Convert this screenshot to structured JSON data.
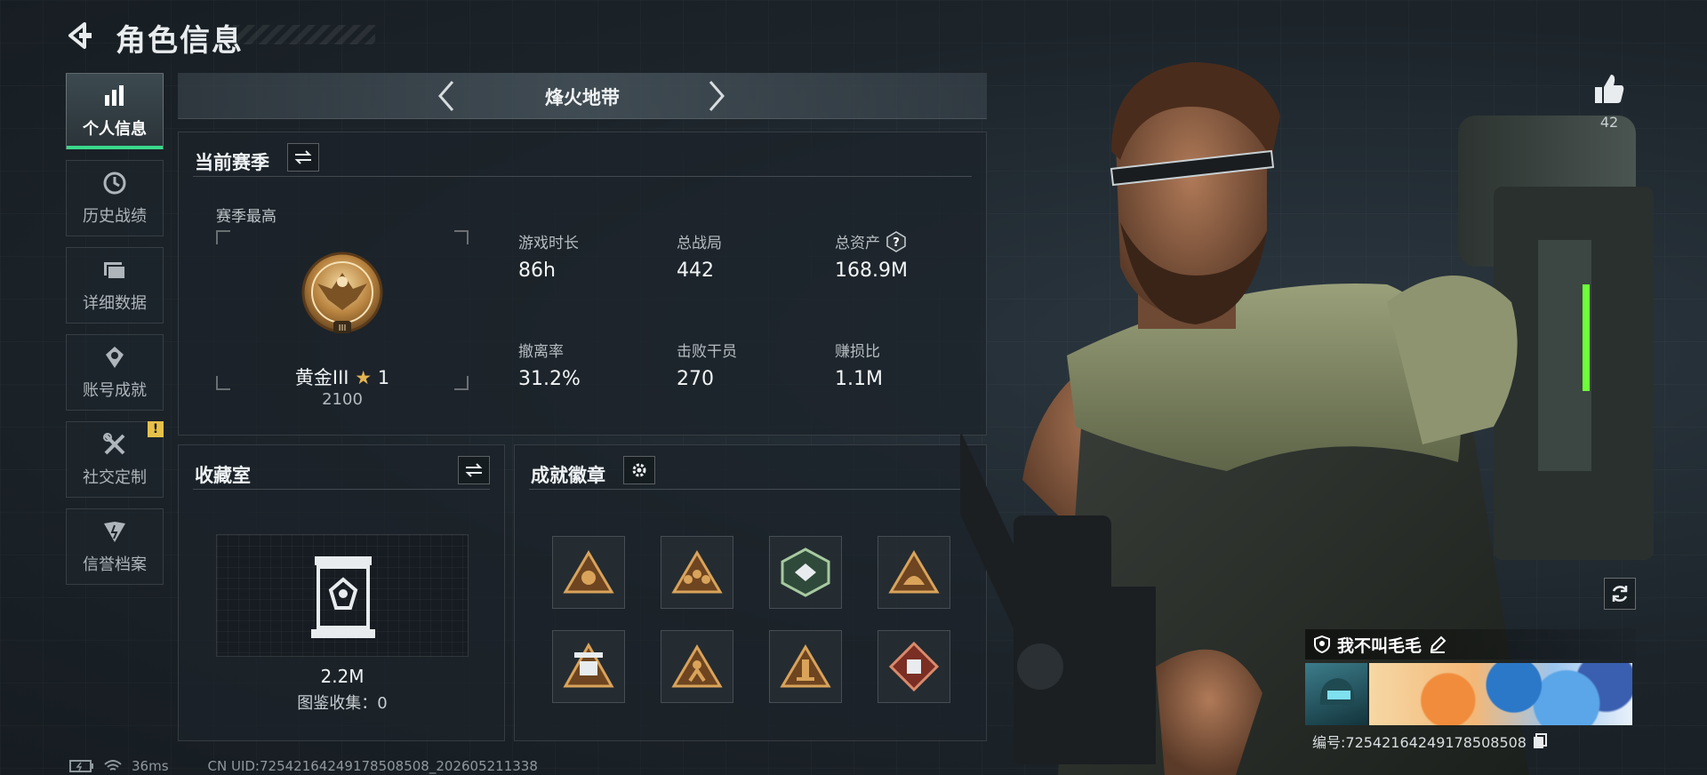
{
  "header": {
    "title": "角色信息",
    "back_icon": "back-arrow-icon"
  },
  "sidebar": {
    "items": [
      {
        "label": "个人信息",
        "icon": "bar-chart-icon",
        "active": true
      },
      {
        "label": "历史战绩",
        "icon": "history-clock-icon",
        "active": false
      },
      {
        "label": "详细数据",
        "icon": "folder-icon",
        "active": false
      },
      {
        "label": "账号成就",
        "icon": "achievement-icon",
        "active": false
      },
      {
        "label": "社交定制",
        "icon": "tools-icon",
        "active": false,
        "alert": "!"
      },
      {
        "label": "信誉档案",
        "icon": "reputation-icon",
        "active": false
      }
    ]
  },
  "mode": {
    "name": "烽火地带"
  },
  "season": {
    "title": "当前赛季",
    "best_label": "赛季最高",
    "rank_name": "黄金III",
    "rank_star_count": "1",
    "rank_score": "2100",
    "stats": [
      {
        "label": "游戏时长",
        "value": "86h"
      },
      {
        "label": "总战局",
        "value": "442"
      },
      {
        "label": "总资产",
        "value": "168.9M",
        "help": "?"
      },
      {
        "label": "撤离率",
        "value": "31.2%"
      },
      {
        "label": "击败干员",
        "value": "270"
      },
      {
        "label": "赚损比",
        "value": "1.1M"
      }
    ]
  },
  "collection": {
    "title": "收藏室",
    "value": "2.2M",
    "count_label": "图鉴收集：0"
  },
  "badges": {
    "title": "成就徽章",
    "items": [
      {
        "icon": "badge-triangle-icon"
      },
      {
        "icon": "badge-squad-icon"
      },
      {
        "icon": "badge-hexagon-icon"
      },
      {
        "icon": "badge-triangle-icon"
      },
      {
        "icon": "badge-robot-icon"
      },
      {
        "icon": "badge-figure-icon"
      },
      {
        "icon": "badge-tower-icon"
      },
      {
        "icon": "badge-diamond-icon"
      }
    ]
  },
  "social": {
    "like_count": "42"
  },
  "player": {
    "name": "我不叫毛毛",
    "uid_label": "编号:7254216424917850850​8"
  },
  "footer": {
    "ping": "36ms",
    "uid": "CN UID:7254216424917850850​8_20260521133​8"
  },
  "colors": {
    "accent": "#39d98a",
    "gold": "#c8963c",
    "alert": "#e6c14a"
  }
}
